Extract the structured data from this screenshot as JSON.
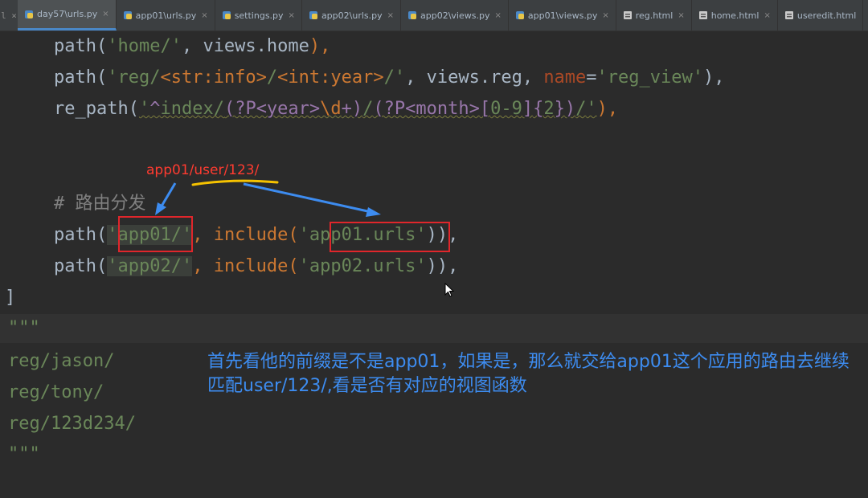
{
  "tabs": [
    {
      "label": "day57\\urls.py",
      "active": true
    },
    {
      "label": "app01\\urls.py",
      "active": false
    },
    {
      "label": "settings.py",
      "active": false
    },
    {
      "label": "app02\\urls.py",
      "active": false
    },
    {
      "label": "app02\\views.py",
      "active": false
    },
    {
      "label": "app01\\views.py",
      "active": false
    },
    {
      "label": "reg.html",
      "active": false
    },
    {
      "label": "home.html",
      "active": false
    },
    {
      "label": "useredit.html",
      "active": false
    }
  ],
  "code": {
    "l1": {
      "a": "path(",
      "s": "'home/'",
      "b": ", views.home",
      "c": "),"
    },
    "l2": {
      "a": "path(",
      "s1": "'reg/",
      "t1": "<str:info>",
      "s2": "/",
      "t2": "<int:year>",
      "s3": "/'",
      "b": ", views.reg, ",
      "p": "name",
      "eq": "=",
      "s4": "'reg_view'",
      "c": "),"
    },
    "l3": {
      "a": "re_path(",
      "q1": "'",
      "r1": "^",
      "s1": "index/",
      "r2": "(?P<year>",
      "e1": "\\d",
      "r3": "+",
      "r4": ")",
      "s2": "/",
      "r5": "(?P<month>",
      "r6": "[",
      "s3": "0-9",
      "r7": "]",
      "r8": "{",
      "s4": "2",
      "r9": "}",
      "r10": ")",
      "s5": "/",
      "q2": "'",
      "c": "),"
    },
    "comment": "# 路由分发",
    "l5": {
      "a": "path(",
      "s1": "'app01/'",
      "b": ", include(",
      "s2": "'app01.urls'",
      "c": ")),"
    },
    "l6": {
      "a": "path(",
      "s1": "'app02/'",
      "b": ", include(",
      "s2": "'app02.urls'",
      "c": ")),"
    },
    "close_bracket": "]",
    "docstring_open": "\"\"\"",
    "doc_lines": [
      "reg/jason/",
      "reg/tony/",
      "reg/123d234/"
    ],
    "docstring_close": "\"\"\""
  },
  "annotation": {
    "route": "app01/user/123/",
    "note": "首先看他的前缀是不是app01，如果是，那么就交给app01这个应用的路由去继续匹配user/123/,看是否有对应的视图函数",
    "color_red": "#e0262b",
    "color_blue": "#3d8cf0",
    "color_underline": "#f5c200"
  }
}
